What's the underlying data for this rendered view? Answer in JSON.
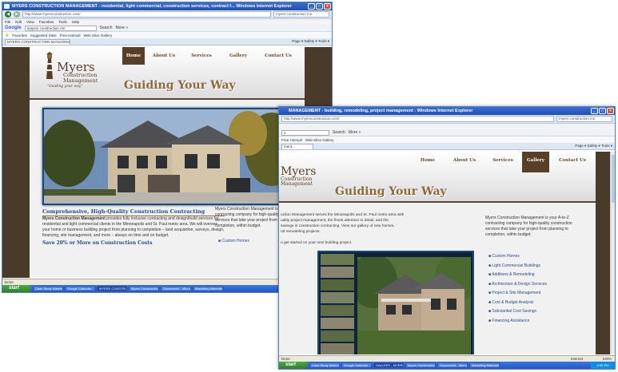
{
  "win1": {
    "title": "MYERS CONSTRUCTION MANAGEMENT - residential, light commercial, construction services, contract f... Windows Internet Explorer",
    "url": "http://www.myersconstruction.com/",
    "search": "myers construction mn",
    "menu": [
      "File",
      "Edit",
      "View",
      "Favorites",
      "Tools",
      "Help"
    ],
    "google_logo": "Google",
    "google_query": "mayers construction mn",
    "google_search_btn": "Search",
    "google_more": "More »",
    "favorites_label": "Favorites",
    "suggested_sites": "Suggested Sites",
    "free_hotmail": "Free Hotmail",
    "web_slice": "Web Slice Gallery",
    "tab_title": "MYERS CONSTRUCTION MANAGEMENT - residential, li...",
    "tab_tools": "Page ▾  Safety ▾  Tools ▾",
    "nav": [
      "Home",
      "About Us",
      "Services",
      "Gallery",
      "Contact Us"
    ],
    "logo_title": "Myers",
    "logo_sub1": "Construction",
    "logo_sub2": "Management",
    "logo_slogan": "\"Guiding your way\"",
    "tagline": "Guiding Your Way",
    "heading": "Comprehensive, High-Quality Construction Contracting",
    "body_strong": "Myers Construction Management",
    "body_text": " provides fully inclusive contracting and design/build services for residential and light commercial clients in the Minneapolis and St. Paul metro area. We will oversee your home or business building project from planning to completion – land acquisition, surveys, design, financing, site management, and more – always on time and on budget.",
    "subheading": "Save 20% or More on Construction Costs",
    "sidebar_text": "Myers Construction Management is your A-to-Z contracting company for high-quality construction services that take your project from planning to completion, within budget.",
    "sidebar_item": "Custom Homes",
    "status_left": "Done",
    "status_zone": "Internet",
    "status_zoom": "100%"
  },
  "win2": {
    "title": "MANAGEMENT - building, remodeling, project management - Windows Internet Explorer",
    "url": "http://www.myersconstruction.com/",
    "search": "myers construction mn",
    "google_query": "n",
    "google_search_btn": "Search",
    "google_more": "More »",
    "free_hotmail": "Free Hotmail",
    "web_slice": "Web Slice Gallery",
    "tab_title": "ment...",
    "tab_tools": "Page ▾  Safety ▾  Tools ▾",
    "nav": [
      "Home",
      "About Us",
      "Services",
      "Gallery",
      "Contact Us"
    ],
    "logo_title": "Myers",
    "logo_sub1": "Construction",
    "logo_sub2": "Management",
    "tagline": "Guiding Your Way",
    "intro_line1": "uction Management serves the Minneapolis and St. Paul metro area with",
    "intro_line2": "uality project management, the finest attention to detail, and the",
    "intro_line3": "savings in construction contracting. View our gallery of new homes,",
    "intro_line4": "nd remodeling projects.",
    "cta": "o get started on your next building project.",
    "sidebar_text": "Myers Construction Management is your A-to-Z contracting company for high-quality construction services that take your project from planning to completion, within budget.",
    "services": [
      "Custom Homes",
      "Light Commercial Buildings",
      "Additions & Remodeling",
      "Architecture & Design Services",
      "Project & Site Management",
      "Cost & Budget Analysis",
      "Substantial Cost Savings",
      "Financing Assistance"
    ],
    "status_left": "Done",
    "status_zone": "Internet",
    "status_zoom": "100%"
  },
  "taskbar1": {
    "start": "start",
    "tasks": [
      "Case Study Materials",
      "Google Calendar - Wi...",
      "MYERS CONSTRUCTI...",
      "Myers Construction I...",
      "Document4 - Microsof...",
      "Marketing Materials"
    ],
    "time": "2:53 PM"
  },
  "taskbar2": {
    "start": "start",
    "tasks": [
      "Case Study Materials",
      "Google Calendar - Wi...",
      "GALLERY - MYERS C...",
      "Myers Construction I...",
      "Document4 - Microsof...",
      "Marketing Materials"
    ],
    "time": "2:55 PM"
  },
  "colors": {
    "brown": "#5a3f28",
    "gold": "#8b6b3c",
    "xp_blue": "#2356c8",
    "link_blue": "#2a4a8a"
  }
}
